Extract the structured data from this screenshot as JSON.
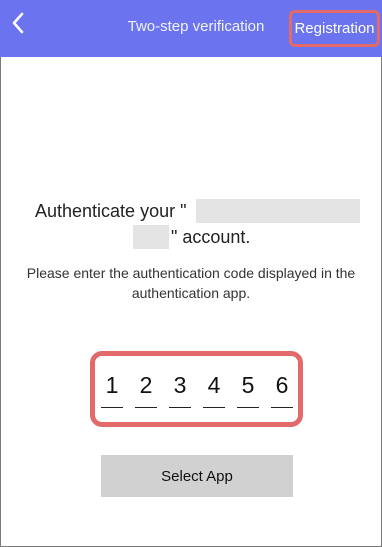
{
  "header": {
    "title": "Two-step verification",
    "registration_label": "Registration",
    "back_icon": "chevron-left-icon"
  },
  "main": {
    "heading_prefix": "Authenticate your \"",
    "heading_suffix": "\" account.",
    "instruction": "Please enter the authentication code displayed in the authentication app.",
    "code_digits": [
      "1",
      "2",
      "3",
      "4",
      "5",
      "6"
    ],
    "select_app_label": "Select App"
  },
  "colors": {
    "header_bg": "#6b74ee",
    "highlight_border": "#e36a6a",
    "button_bg": "#d1d1d1"
  }
}
